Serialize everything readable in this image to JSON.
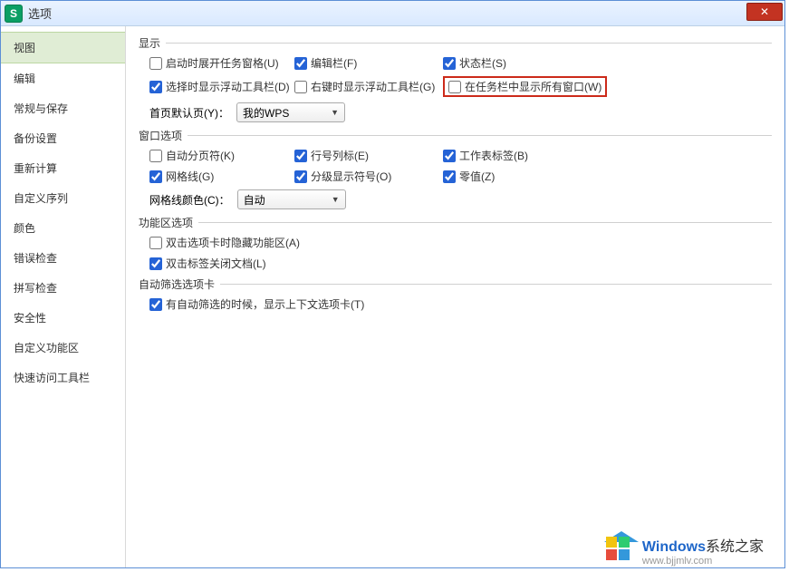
{
  "title": "选项",
  "app_icon_letter": "S",
  "sidebar": {
    "items": [
      {
        "label": "视图"
      },
      {
        "label": "编辑"
      },
      {
        "label": "常规与保存"
      },
      {
        "label": "备份设置"
      },
      {
        "label": "重新计算"
      },
      {
        "label": "自定义序列"
      },
      {
        "label": "颜色"
      },
      {
        "label": "错误检查"
      },
      {
        "label": "拼写检查"
      },
      {
        "label": "安全性"
      },
      {
        "label": "自定义功能区"
      },
      {
        "label": "快速访问工具栏"
      }
    ]
  },
  "groups": {
    "display": {
      "title": "显示",
      "startup_taskpane": "启动时展开任务窗格(U)",
      "formula_bar": "编辑栏(F)",
      "status_bar": "状态栏(S)",
      "show_floating_on_select": "选择时显示浮动工具栏(D)",
      "show_floating_on_rightclick": "右键时显示浮动工具栏(G)",
      "show_all_windows_in_taskbar": "在任务栏中显示所有窗口(W)",
      "default_page_label": "首页默认页(Y)：",
      "default_page_value": "我的WPS"
    },
    "window": {
      "title": "窗口选项",
      "auto_page_break": "自动分页符(K)",
      "row_col_headers": "行号列标(E)",
      "sheet_tabs": "工作表标签(B)",
      "gridlines": "网格线(G)",
      "outline_symbols": "分级显示符号(O)",
      "zero_values": "零值(Z)",
      "gridline_color_label": "网格线颜色(C)：",
      "gridline_color_value": "自动"
    },
    "ribbon": {
      "title": "功能区选项",
      "dblclick_hide_ribbon": "双击选项卡时隐藏功能区(A)",
      "dblclick_close_doc": "双击标签关闭文档(L)"
    },
    "autofilter": {
      "title": "自动筛选选项卡",
      "show_context_tab": "有自动筛选的时候，显示上下文选项卡(T)"
    }
  },
  "watermark": {
    "brand": "Windows",
    "suffix": "系统之家",
    "url": "www.bjjmlv.com"
  }
}
